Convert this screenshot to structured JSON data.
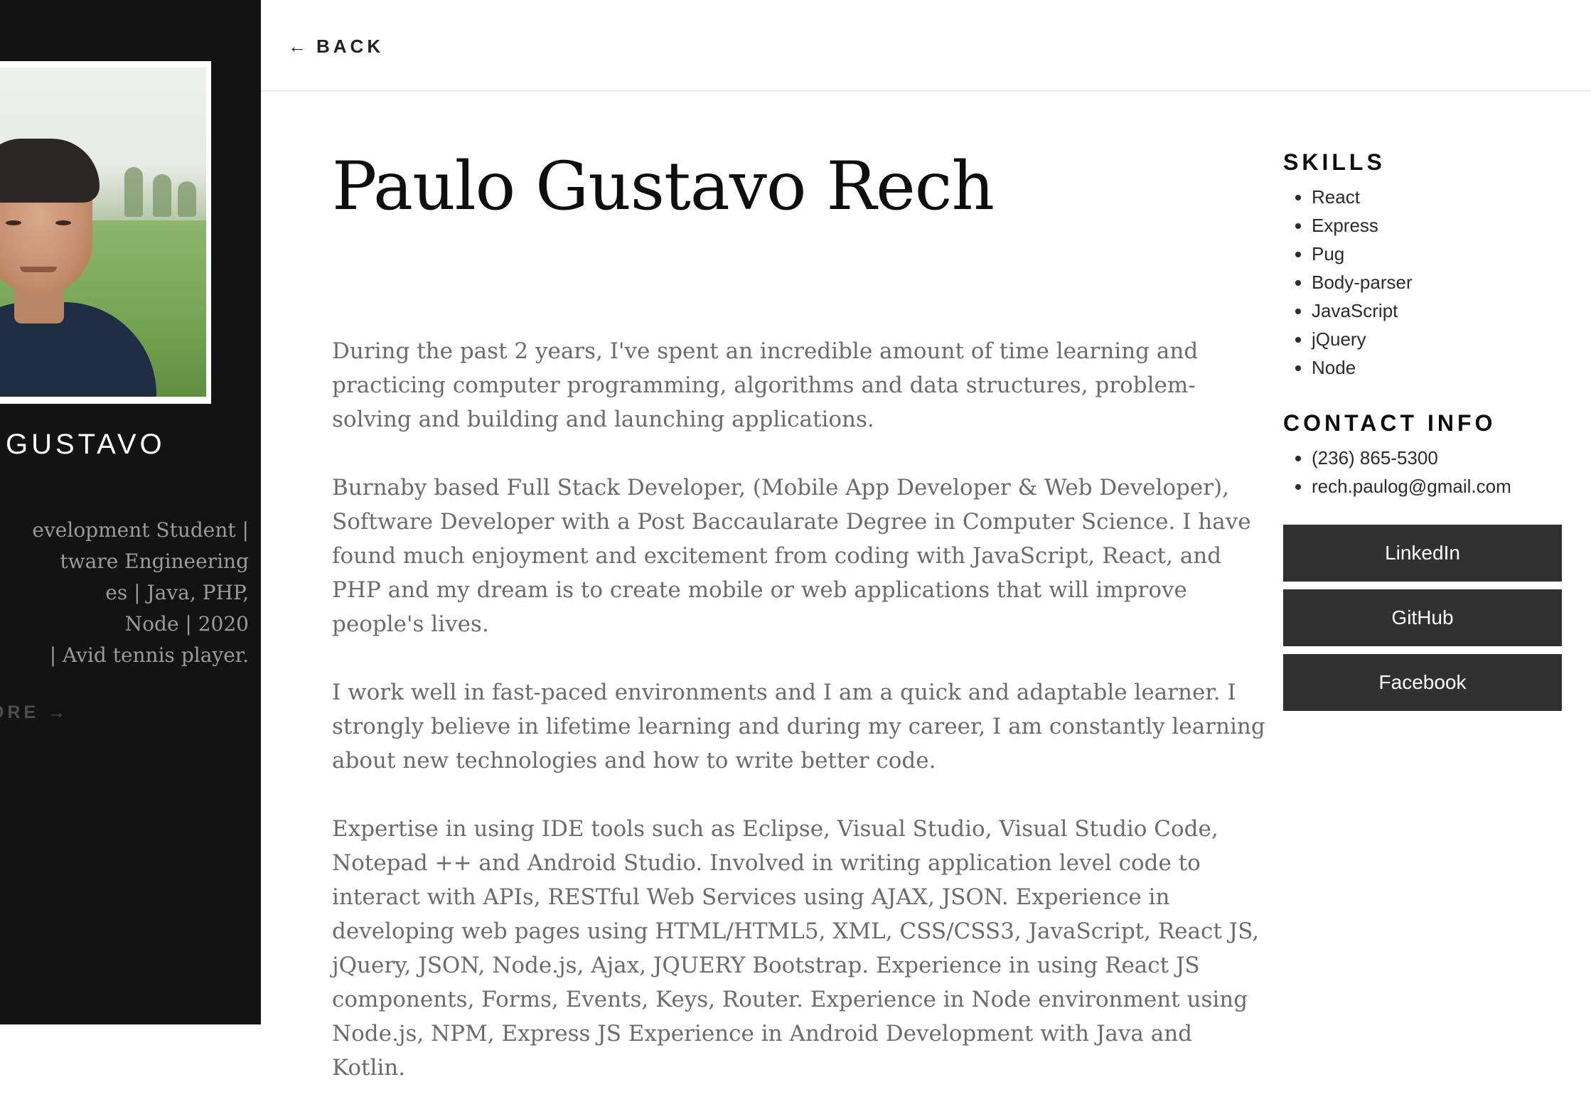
{
  "nav": {
    "back_arrow": "←",
    "back_label": "BACK"
  },
  "sidebar": {
    "name": "GUSTAVO",
    "bio_lines": [
      "evelopment Student |",
      "tware Engineering",
      "es | Java, PHP,",
      "Node | 2020",
      "| Avid tennis player."
    ],
    "more_label": "ORE →"
  },
  "profile": {
    "name": "Paulo Gustavo Rech",
    "paragraphs": [
      "During the past 2 years, I've spent an incredible amount of time learning and practicing computer programming, algorithms and data structures, problem-solving and building and launching applications.",
      "Burnaby based Full Stack Developer, (Mobile App Developer & Web Developer), Software Developer with a Post Baccaularate Degree in Computer Science. I have found much enjoyment and excitement from coding with JavaScript, React, and PHP and my dream is to create mobile or web applications that will improve people's lives.",
      "I work well in fast-paced environments and I am a quick and adaptable learner. I strongly believe in lifetime learning and during my career, I am constantly learning about new technologies and how to write better code.",
      "Expertise in using IDE tools such as Eclipse, Visual Studio, Visual Studio Code, Notepad ++ and Android Studio. Involved in writing application level code to interact with APIs, RESTful Web Services using AJAX, JSON. Experience in developing web pages using HTML/HTML5, XML, CSS/CSS3, JavaScript, React JS, jQuery, JSON, Node.js, Ajax, JQUERY Bootstrap. Experience in using React JS components, Forms, Events, Keys, Router. Experience in Node environment using Node.js, NPM, Express JS Experience in Android Development with Java and Kotlin."
    ]
  },
  "skills": {
    "title": "SKILLS",
    "items": [
      "React",
      "Express",
      "Pug",
      "Body-parser",
      "JavaScript",
      "jQuery",
      "Node"
    ]
  },
  "contact": {
    "title": "CONTACT INFO",
    "phone": "(236) 865-5300",
    "email": "rech.paulog@gmail.com"
  },
  "social": {
    "linkedin": "LinkedIn",
    "github": "GitHub",
    "facebook": "Facebook"
  },
  "colors": {
    "sidebar_bg": "#131313",
    "button_bg": "#313131",
    "body_text": "#6b6b6b"
  }
}
